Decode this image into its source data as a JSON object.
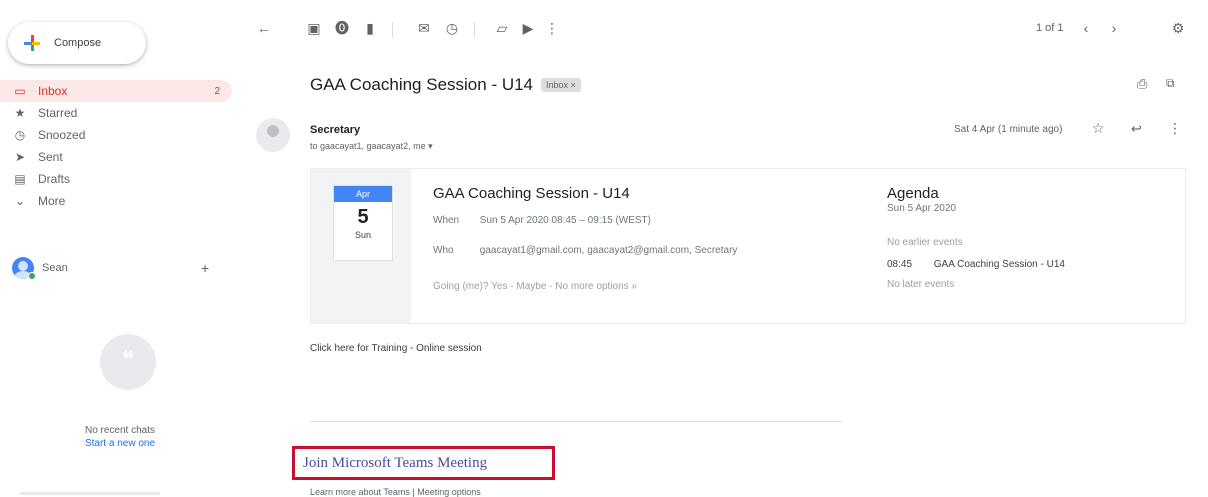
{
  "sidebar": {
    "compose_label": "Compose",
    "items": [
      {
        "label": "Inbox",
        "icon": "inbox-icon",
        "count": "2",
        "active": true
      },
      {
        "label": "Starred",
        "icon": "star-icon"
      },
      {
        "label": "Snoozed",
        "icon": "clock-icon"
      },
      {
        "label": "Sent",
        "icon": "send-icon"
      },
      {
        "label": "Drafts",
        "icon": "draft-icon"
      },
      {
        "label": "More",
        "icon": "chevron-down-icon"
      }
    ],
    "meet_user": "Sean",
    "no_chats": "No recent chats",
    "start_new": "Start a new one"
  },
  "toolbar": {
    "pager": "1 of 1"
  },
  "message": {
    "subject": "GAA Coaching Session - U14",
    "chip": "Inbox ×",
    "sender": "Secretary",
    "to": "to gaacayat1, gaacayat2, me ▾",
    "date": "Sat 4 Apr (1 minute ago)",
    "body_line": "Click here for Training - Online session",
    "join_link": "Join Microsoft Teams Meeting",
    "bottom_links": "Learn more about Teams | Meeting options"
  },
  "event": {
    "month": "Apr",
    "day": "5",
    "dow": "Sun",
    "title": "GAA Coaching Session - U14",
    "when_k": "When",
    "when_v": "Sun 5 Apr 2020 08:45 – 09:15 (WEST)",
    "who_k": "Who",
    "who_v": "gaacayat1@gmail.com, gaacayat2@gmail.com, Secretary",
    "footer": "Going (me)? Yes - Maybe - No   more options »"
  },
  "agenda": {
    "heading": "Agenda",
    "date": "Sun 5 Apr 2020",
    "no_earlier": "No earlier events",
    "ev_time": "08:45",
    "ev_title": "GAA Coaching Session - U14",
    "no_later": "No later events"
  }
}
